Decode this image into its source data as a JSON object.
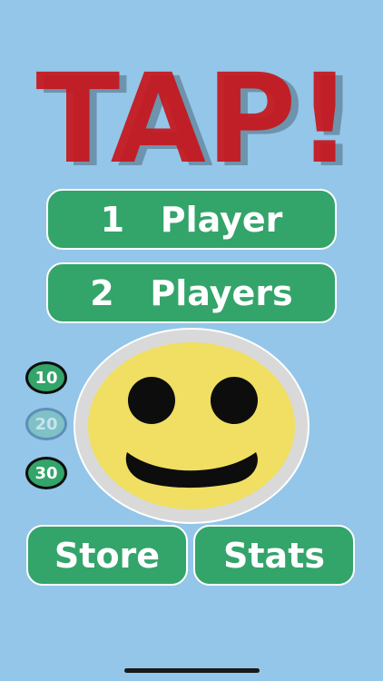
{
  "title": "TAP!",
  "menu": {
    "one_player": "1   Player",
    "two_players": "2   Players",
    "store": "Store",
    "stats": "Stats"
  },
  "time_options": [
    "10",
    "20",
    "30"
  ],
  "selected_time_option": "20",
  "colors": {
    "background": "#93c6e8",
    "button_green": "#33a46a",
    "title_red": "#c8161c",
    "smiley_yellow": "#f0df62"
  }
}
